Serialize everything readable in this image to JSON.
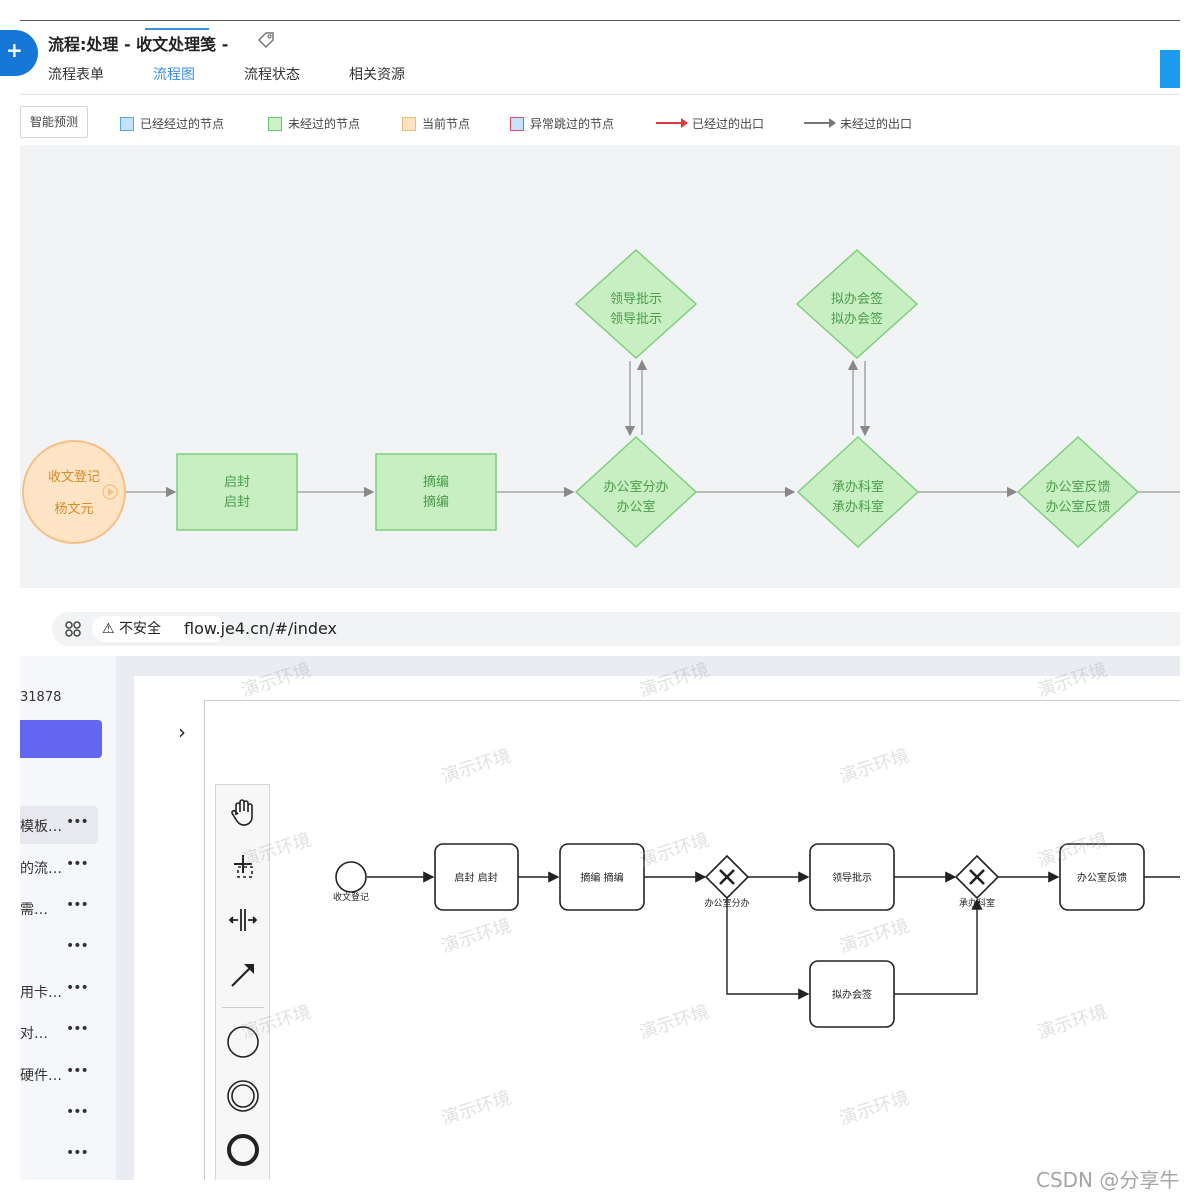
{
  "top": {
    "title": "流程:处理 - 收文处理笺 -",
    "tabs": [
      "流程表单",
      "流程图",
      "流程状态",
      "相关资源"
    ],
    "active_tab": "流程图",
    "predict_button": "智能预测",
    "legend": [
      {
        "label": "已经经过的节点",
        "kind": "swatch",
        "fill": "#c6e2fb",
        "border": "#5aa6e8"
      },
      {
        "label": "未经过的节点",
        "kind": "swatch",
        "fill": "#cdf0c6",
        "border": "#6cc26c"
      },
      {
        "label": "当前节点",
        "kind": "swatch",
        "fill": "#fde3c2",
        "border": "#f5b77a"
      },
      {
        "label": "异常跳过的节点",
        "kind": "swatch",
        "fill": "#c6e2fb",
        "border": "#e04c6a"
      },
      {
        "label": "已经过的出口",
        "kind": "arrow",
        "color": "#e0393e"
      },
      {
        "label": "未经过的出口",
        "kind": "arrow",
        "color": "#777777"
      }
    ],
    "nodes": {
      "start": {
        "line1": "收文登记",
        "line2": "杨文元"
      },
      "qifeng": {
        "line1": "启封",
        "line2": "启封"
      },
      "zhaibian": {
        "line1": "摘编",
        "line2": "摘编"
      },
      "fenban": {
        "line1": "办公室分办",
        "line2": "办公室"
      },
      "chengban": {
        "line1": "承办科室",
        "line2": "承办科室"
      },
      "fankui": {
        "line1": "办公室反馈",
        "line2": "办公室反馈"
      },
      "pishi": {
        "line1": "领导批示",
        "line2": "领导批示"
      },
      "huiqian": {
        "line1": "拟办会签",
        "line2": "拟办会签"
      }
    },
    "colors": {
      "green_fill": "#c7efc2",
      "green_border": "#7fcf7f",
      "green_text": "#4a9c4a",
      "orange_fill": "#fde4c4",
      "orange_border": "#f6bf85",
      "orange_text": "#d88a2c",
      "link": "#3b8ee6"
    }
  },
  "bottom": {
    "insecure_label": "不安全",
    "url": "flow.je4.cn/#/index",
    "sidebar_id": "31878",
    "sidebar_items": [
      "模板…",
      "的流…",
      "需…",
      "",
      "用卡…",
      "对…",
      "硬件…",
      "",
      ""
    ],
    "menu_dots": "•••",
    "watermark": "演示环境",
    "nodes": {
      "start_label": "收文登记",
      "qifeng": "启封 启封",
      "zhaibian": "摘编 摘编",
      "gateway1": "办公室分办",
      "pishi": "领导批示",
      "gateway2": "承办科室",
      "fankui": "办公室反馈",
      "huiqian": "拟办会签"
    },
    "accent": "#6366f1"
  },
  "credit": "CSDN @分享牛"
}
